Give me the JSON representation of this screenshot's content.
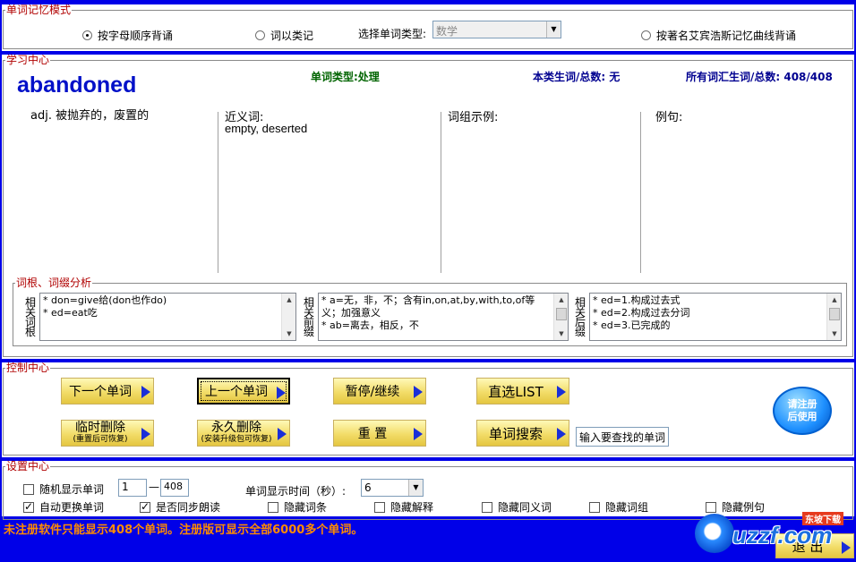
{
  "memory_mode": {
    "legend": "单词记忆模式",
    "options": [
      {
        "label": "按字母顺序背诵",
        "checked": true
      },
      {
        "label": "词以类记",
        "checked": false
      },
      {
        "label": "按著名艾宾浩斯记忆曲线背诵",
        "checked": false
      }
    ],
    "type_label": "选择单词类型:",
    "type_value": "数学"
  },
  "study": {
    "legend": "学习中心",
    "word": "abandoned",
    "word_type": "单词类型:处理",
    "class_count": "本类生词/总数: 无",
    "all_count": "所有词汇生词/总数: 408/408",
    "definition": "adj. 被抛弃的，废置的",
    "synonyms_label": "近义词:",
    "synonyms_value": "empty, deserted",
    "phrases_label": "词组示例:",
    "examples_label": "例句:"
  },
  "roots": {
    "legend": "词根、词缀分析",
    "root_label": "相关词根",
    "root_lines": [
      "* don=give给(don也作do)",
      "* ed=eat吃"
    ],
    "prefix_label": "相关前缀",
    "prefix_lines": [
      "* a=无，非，不；含有in,on,at,by,with,to,of等义；加强意义",
      "* ab=离去，相反，不"
    ],
    "suffix_label": "相关后缀",
    "suffix_lines": [
      "* ed=1.构成过去式",
      "* ed=2.构成过去分词",
      "* ed=3.已完成的"
    ]
  },
  "control": {
    "legend": "控制中心",
    "next": "下一个单词",
    "prev": "上一个单词",
    "pause": "暂停/继续",
    "direct_list": "直选LIST",
    "temp_delete": "临时删除",
    "temp_delete_sub": "(重置后可恢复)",
    "perm_delete": "永久删除",
    "perm_delete_sub": "(安装升级包可恢复)",
    "reset": "重 置",
    "search": "单词搜索",
    "search_placeholder": "输入要查找的单词",
    "register": "请注册后使用"
  },
  "settings": {
    "legend": "设置中心",
    "random_label": "随机显示单词",
    "random_checked": false,
    "range_from": "1",
    "range_sep": "—",
    "range_to": "408",
    "time_label": "单词显示时间（秒）:",
    "time_value": "6",
    "auto_label": "自动更换单词",
    "auto_checked": true,
    "sync_label": "是否同步朗读",
    "sync_checked": true,
    "hide_entry": "隐藏词条",
    "hide_explain": "隐藏解释",
    "hide_synonym": "隐藏同义词",
    "hide_phrase": "隐藏词组",
    "hide_example": "隐藏例句"
  },
  "status": {
    "notice": "未注册软件只能显示408个单词。注册版可显示全部6000多个单词。",
    "exit": "退 出",
    "watermark": "uzzf.com",
    "watermark_sub": "东坡下载"
  }
}
